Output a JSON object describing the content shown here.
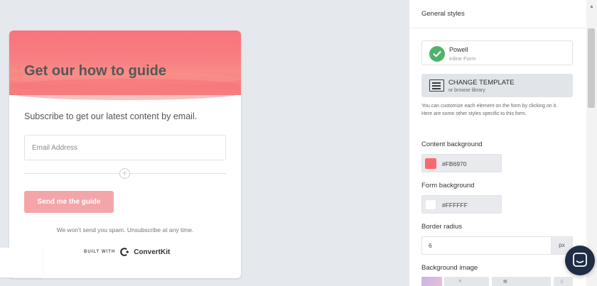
{
  "form_preview": {
    "title": "Get our how to guide",
    "subtitle": "Subscribe to get our latest content by email.",
    "email_placeholder": "Email Address",
    "submit_label": "Send me the guide",
    "spam_note": "We won't send you spam. Unsubscribe at any time.",
    "built_with_label": "BUILT WITH",
    "brand_name": "ConvertKit",
    "accent_color": "#FB6970"
  },
  "panel": {
    "title": "General styles",
    "template": {
      "name": "Powell",
      "type": "Inline Form",
      "icon": "check-circle-icon"
    },
    "change_template": {
      "label": "CHANGE TEMPLATE",
      "sublabel": "or browse library",
      "icon": "template-icon"
    },
    "helper_text": "You can customize each element on the form by clicking on it. Here are some other styles specific to this form.",
    "content_background": {
      "label": "Content background",
      "value": "#FB6970",
      "swatch": "#FB6970"
    },
    "form_background": {
      "label": "Form background",
      "value": "#FFFFFF",
      "swatch": "#FFFFFF"
    },
    "border_radius": {
      "label": "Border radius",
      "value": "6",
      "unit": "px"
    },
    "background_image": {
      "label": "Background image"
    }
  },
  "chat": {
    "icon": "chat-icon"
  }
}
